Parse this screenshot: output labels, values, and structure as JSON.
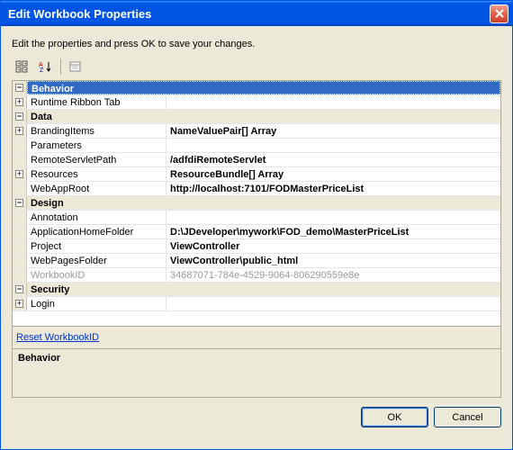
{
  "window": {
    "title": "Edit Workbook Properties"
  },
  "instruction": "Edit the properties and press OK to save your changes.",
  "categories": {
    "behavior": "Behavior",
    "data": "Data",
    "design": "Design",
    "security": "Security"
  },
  "props": {
    "runtime_ribbon_tab": {
      "label": "Runtime Ribbon Tab",
      "value": ""
    },
    "branding_items": {
      "label": "BrandingItems",
      "value": "NameValuePair[] Array"
    },
    "parameters": {
      "label": "Parameters",
      "value": ""
    },
    "remote_servlet_path": {
      "label": "RemoteServletPath",
      "value": "/adfdiRemoteServlet"
    },
    "resources": {
      "label": "Resources",
      "value": "ResourceBundle[] Array"
    },
    "web_app_root": {
      "label": "WebAppRoot",
      "value": "http://localhost:7101/FODMasterPriceList"
    },
    "annotation": {
      "label": "Annotation",
      "value": ""
    },
    "application_home_folder": {
      "label": "ApplicationHomeFolder",
      "value": "D:\\JDeveloper\\mywork\\FOD_demo\\MasterPriceList"
    },
    "project": {
      "label": "Project",
      "value": "ViewController"
    },
    "web_pages_folder": {
      "label": "WebPagesFolder",
      "value": "ViewController\\public_html"
    },
    "workbook_id": {
      "label": "WorkbookID",
      "value": "34687071-784e-4529-9064-806290559e8e"
    },
    "login": {
      "label": "Login",
      "value": ""
    }
  },
  "link": {
    "reset_workbook_id": "Reset WorkbookID"
  },
  "description_title": "Behavior",
  "buttons": {
    "ok": "OK",
    "cancel": "Cancel"
  }
}
